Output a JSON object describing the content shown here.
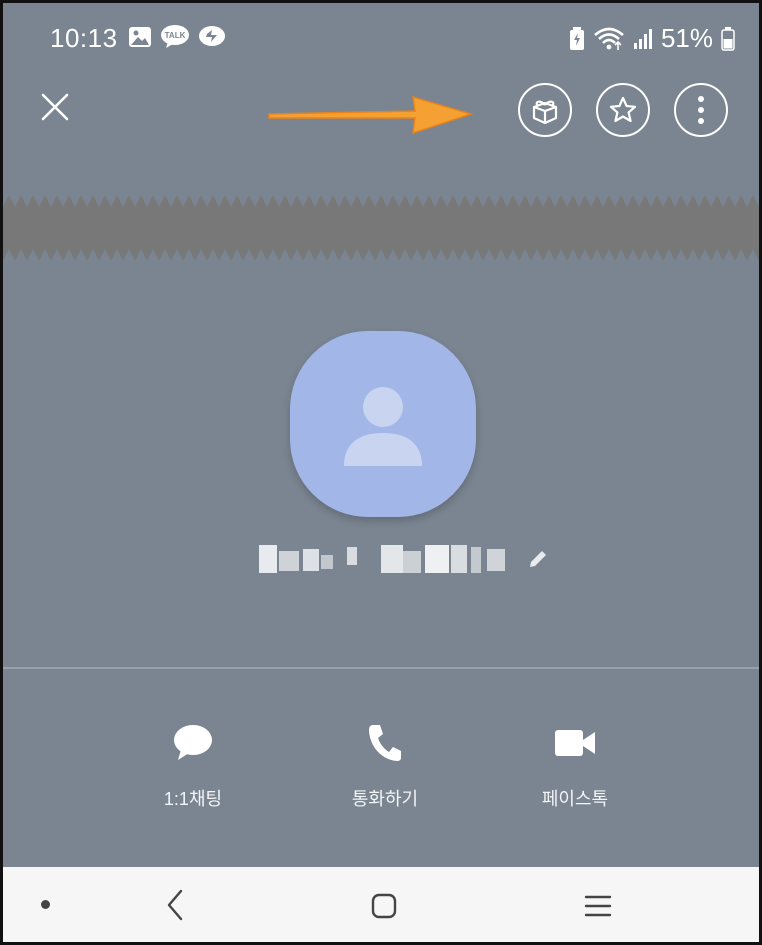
{
  "status_bar": {
    "time": "10:13",
    "battery": "51%",
    "left_icons": [
      "gallery-icon",
      "kakaotalk-talk-icon",
      "kakaotalk-chat-icon"
    ],
    "talk_badge": "TALK",
    "right_icons": [
      "battery-saver-icon",
      "wifi-icon",
      "signal-icon",
      "battery-icon"
    ]
  },
  "toolbar": {
    "close_icon": "close-icon",
    "buttons": [
      "gift-icon",
      "star-icon",
      "more-vertical-icon"
    ]
  },
  "profile": {
    "avatar_icon": "person-icon",
    "name_redacted": true,
    "edit_icon": "pencil-icon"
  },
  "actions": [
    {
      "label": "1:1채팅",
      "icon": "chat-bubble-icon"
    },
    {
      "label": "통화하기",
      "icon": "phone-icon"
    },
    {
      "label": "페이스톡",
      "icon": "video-camera-icon"
    }
  ],
  "nav_bar": {
    "icons": [
      "dot-icon",
      "back-icon",
      "home-icon",
      "recent-apps-icon"
    ]
  },
  "colors": {
    "background": "#7a8591",
    "avatar": "#a2b6e8",
    "arrow": "#f5a033",
    "nav_bar": "#f6f6f6"
  }
}
